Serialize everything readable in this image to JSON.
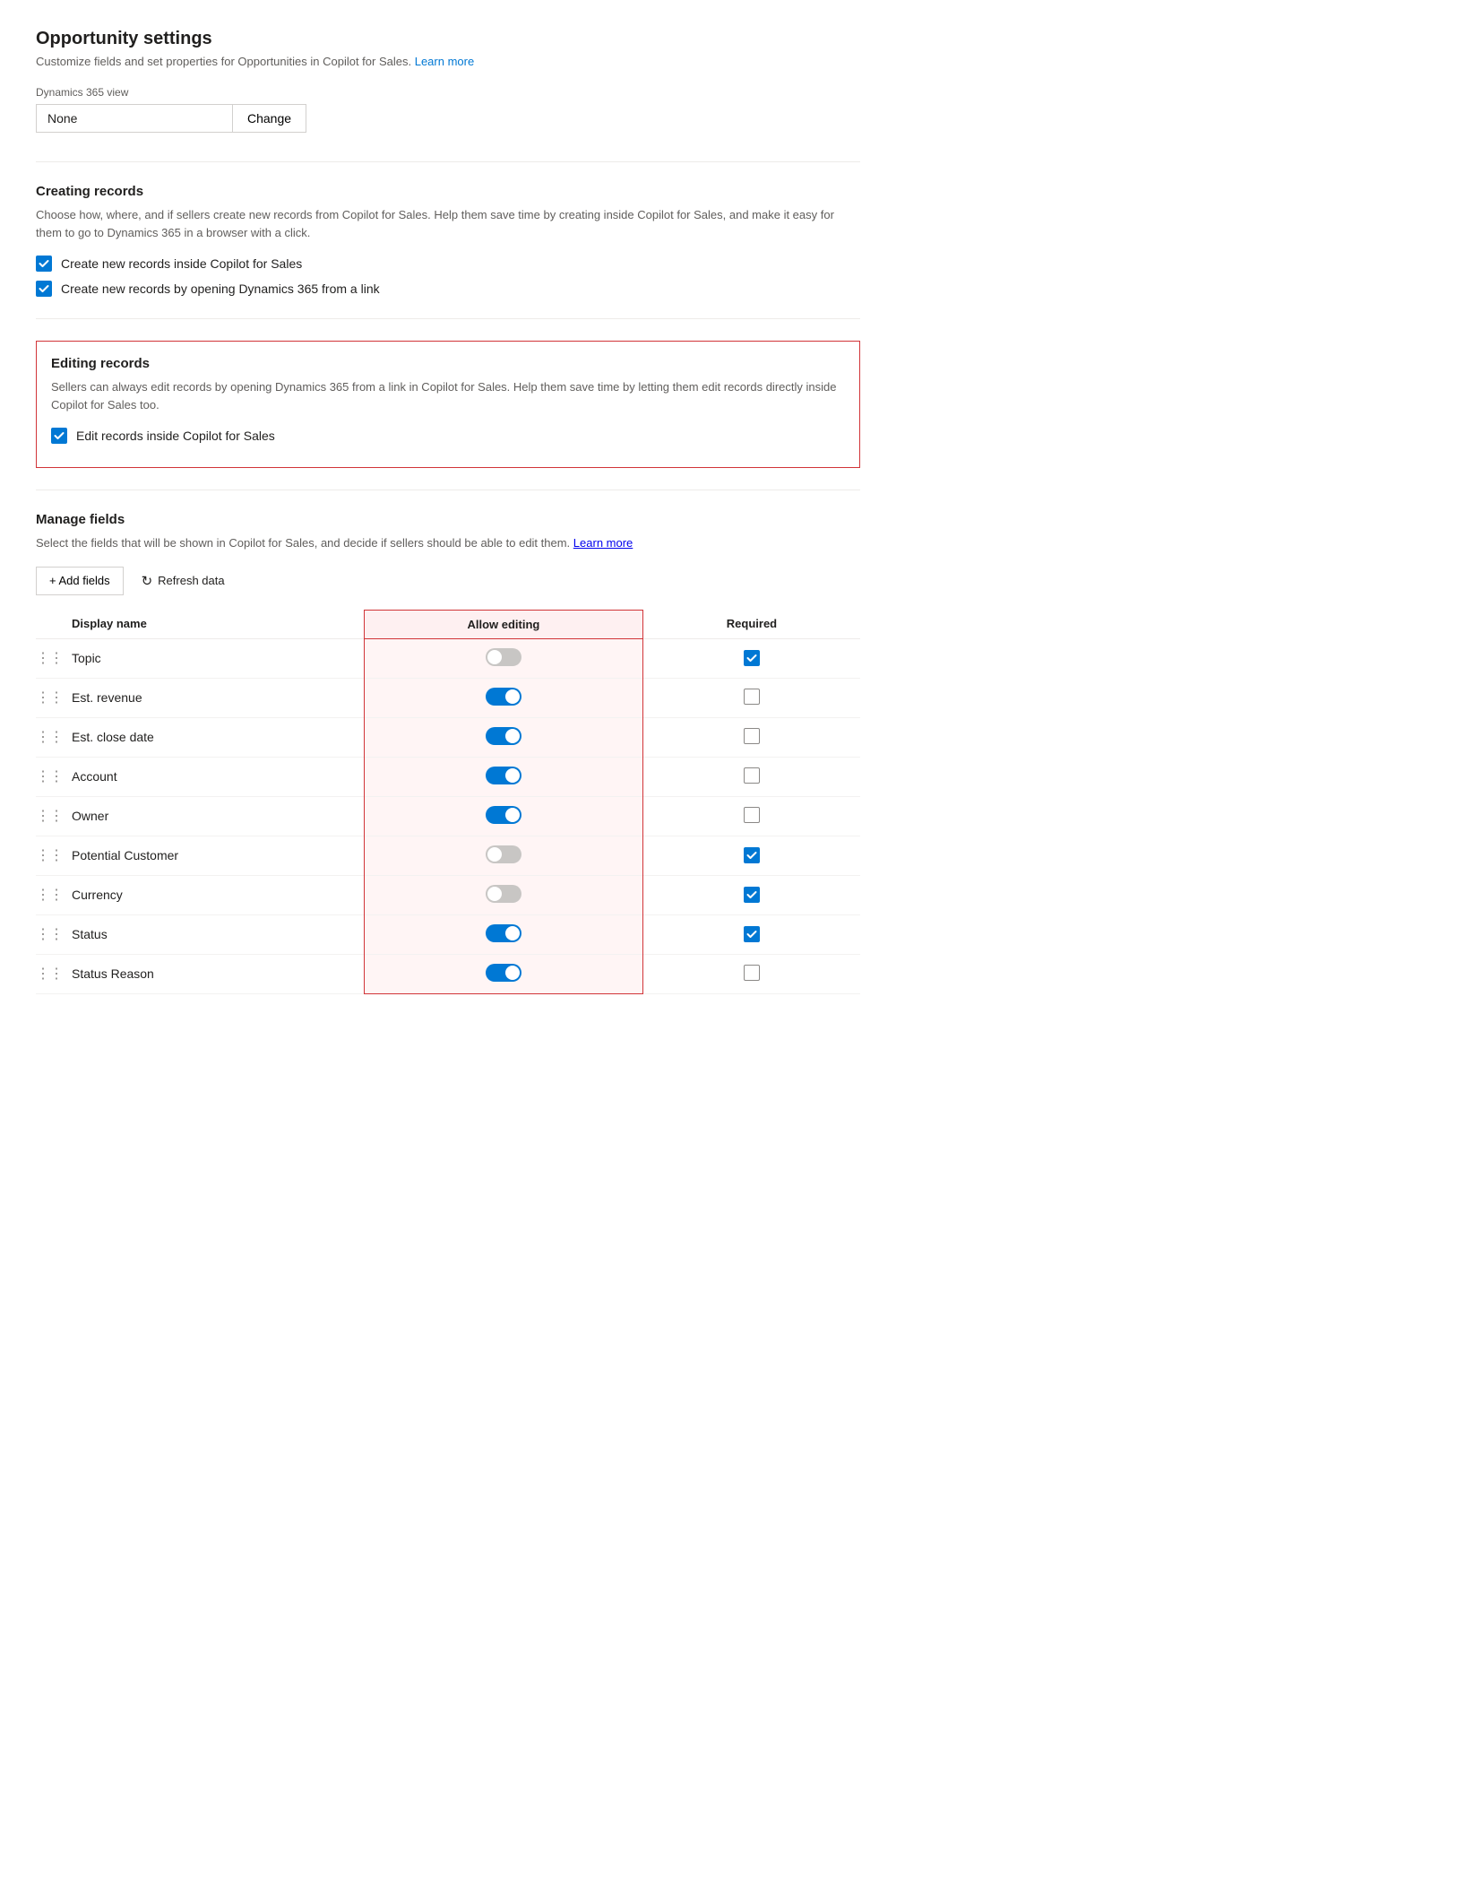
{
  "page": {
    "title": "Opportunity settings",
    "subtitle": "Customize fields and set properties for Opportunities in Copilot for Sales.",
    "learn_more_link": "Learn more",
    "dynamics_view_label": "Dynamics 365 view",
    "dynamics_view_value": "None",
    "change_button": "Change"
  },
  "creating_records": {
    "title": "Creating records",
    "description": "Choose how, where, and if sellers create new records from Copilot for Sales. Help them save time by creating inside Copilot for Sales, and make it easy for them to go to Dynamics 365 in a browser with a click.",
    "checkboxes": [
      {
        "id": "create1",
        "checked": true,
        "label": "Create new records inside Copilot for Sales"
      },
      {
        "id": "create2",
        "checked": true,
        "label": "Create new records by opening Dynamics 365 from a link"
      }
    ]
  },
  "editing_records": {
    "title": "Editing records",
    "description": "Sellers can always edit records by opening Dynamics 365 from a link in Copilot for Sales. Help them save time by letting them edit records directly inside Copilot for Sales too.",
    "checkboxes": [
      {
        "id": "edit1",
        "checked": true,
        "label": "Edit records inside Copilot for Sales"
      }
    ]
  },
  "manage_fields": {
    "title": "Manage fields",
    "description": "Select the fields that will be shown in Copilot for Sales, and decide if sellers should be able to edit them.",
    "learn_more_link": "Learn more",
    "add_fields_button": "+ Add fields",
    "refresh_button": "Refresh data",
    "table": {
      "col_display_name": "Display name",
      "col_allow_editing": "Allow editing",
      "col_required": "Required",
      "rows": [
        {
          "name": "Topic",
          "allow_editing": false,
          "required": true
        },
        {
          "name": "Est. revenue",
          "allow_editing": true,
          "required": false
        },
        {
          "name": "Est. close date",
          "allow_editing": true,
          "required": false
        },
        {
          "name": "Account",
          "allow_editing": true,
          "required": false
        },
        {
          "name": "Owner",
          "allow_editing": true,
          "required": false
        },
        {
          "name": "Potential Customer",
          "allow_editing": false,
          "required": true
        },
        {
          "name": "Currency",
          "allow_editing": false,
          "required": true
        },
        {
          "name": "Status",
          "allow_editing": true,
          "required": true
        },
        {
          "name": "Status Reason",
          "allow_editing": true,
          "required": false
        }
      ]
    }
  },
  "icons": {
    "checkmark": "✓",
    "drag": "⠿",
    "plus": "+",
    "refresh": "↻"
  }
}
